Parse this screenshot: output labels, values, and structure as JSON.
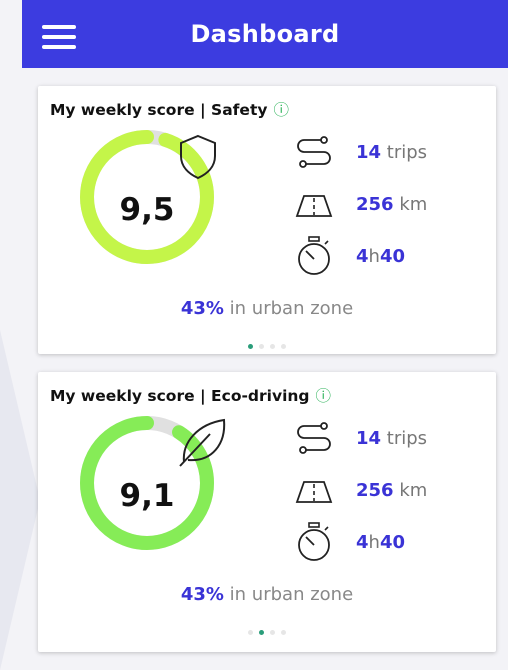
{
  "header": {
    "title": "Dashboard"
  },
  "cards": [
    {
      "title": "My weekly score | Safety",
      "score": "9,5",
      "gauge_fraction": 0.95,
      "gauge_color": "#c4f549",
      "badge_icon": "shield-icon",
      "stats": {
        "trips_value": "14",
        "trips_unit": "trips",
        "distance_value": "256",
        "distance_unit": "km",
        "hours": "4",
        "hours_unit": "h",
        "minutes": "40"
      },
      "urban": {
        "percent": "43%",
        "text": "in urban zone"
      },
      "page_indicator": {
        "count": 4,
        "active": 1
      }
    },
    {
      "title": "My weekly score | Eco-driving",
      "score": "9,1",
      "gauge_fraction": 0.91,
      "gauge_color": "#86ec57",
      "badge_icon": "leaf-icon",
      "stats": {
        "trips_value": "14",
        "trips_unit": "trips",
        "distance_value": "256",
        "distance_unit": "km",
        "hours": "4",
        "hours_unit": "h",
        "minutes": "40"
      },
      "urban": {
        "percent": "43%",
        "text": "in urban zone"
      },
      "page_indicator": {
        "count": 4,
        "active": 2
      }
    }
  ],
  "colors": {
    "header": "#3c3ce0",
    "accent_text": "#3a33d6",
    "info_icon": "#2db35a",
    "gauge_track": "#e0e0e0",
    "dot_active": "#2a9d7a"
  }
}
